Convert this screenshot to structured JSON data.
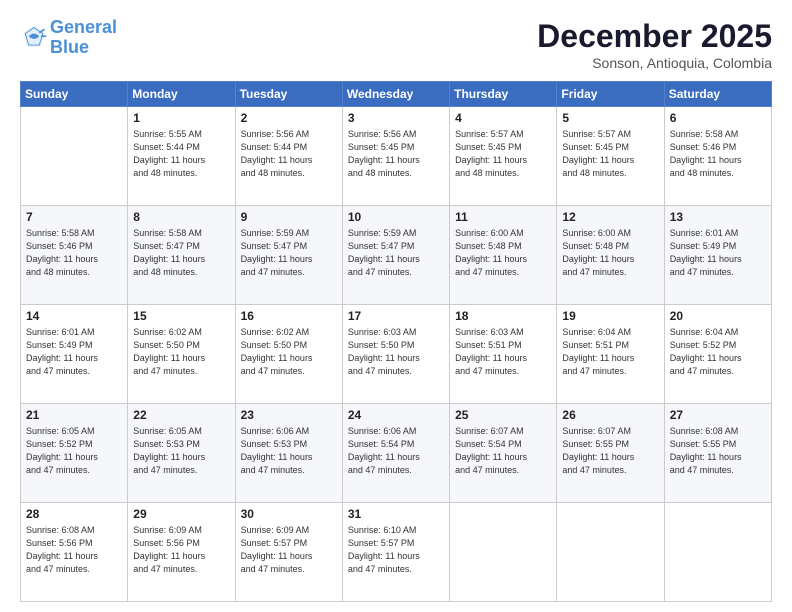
{
  "header": {
    "logo_line1": "General",
    "logo_line2": "Blue",
    "month_title": "December 2025",
    "location": "Sonson, Antioquia, Colombia"
  },
  "weekdays": [
    "Sunday",
    "Monday",
    "Tuesday",
    "Wednesday",
    "Thursday",
    "Friday",
    "Saturday"
  ],
  "weeks": [
    [
      {
        "day": "",
        "sunrise": "",
        "sunset": "",
        "daylight": ""
      },
      {
        "day": "1",
        "sunrise": "Sunrise: 5:55 AM",
        "sunset": "Sunset: 5:44 PM",
        "daylight": "Daylight: 11 hours and 48 minutes."
      },
      {
        "day": "2",
        "sunrise": "Sunrise: 5:56 AM",
        "sunset": "Sunset: 5:44 PM",
        "daylight": "Daylight: 11 hours and 48 minutes."
      },
      {
        "day": "3",
        "sunrise": "Sunrise: 5:56 AM",
        "sunset": "Sunset: 5:45 PM",
        "daylight": "Daylight: 11 hours and 48 minutes."
      },
      {
        "day": "4",
        "sunrise": "Sunrise: 5:57 AM",
        "sunset": "Sunset: 5:45 PM",
        "daylight": "Daylight: 11 hours and 48 minutes."
      },
      {
        "day": "5",
        "sunrise": "Sunrise: 5:57 AM",
        "sunset": "Sunset: 5:45 PM",
        "daylight": "Daylight: 11 hours and 48 minutes."
      },
      {
        "day": "6",
        "sunrise": "Sunrise: 5:58 AM",
        "sunset": "Sunset: 5:46 PM",
        "daylight": "Daylight: 11 hours and 48 minutes."
      }
    ],
    [
      {
        "day": "7",
        "sunrise": "Sunrise: 5:58 AM",
        "sunset": "Sunset: 5:46 PM",
        "daylight": "Daylight: 11 hours and 48 minutes."
      },
      {
        "day": "8",
        "sunrise": "Sunrise: 5:58 AM",
        "sunset": "Sunset: 5:47 PM",
        "daylight": "Daylight: 11 hours and 48 minutes."
      },
      {
        "day": "9",
        "sunrise": "Sunrise: 5:59 AM",
        "sunset": "Sunset: 5:47 PM",
        "daylight": "Daylight: 11 hours and 47 minutes."
      },
      {
        "day": "10",
        "sunrise": "Sunrise: 5:59 AM",
        "sunset": "Sunset: 5:47 PM",
        "daylight": "Daylight: 11 hours and 47 minutes."
      },
      {
        "day": "11",
        "sunrise": "Sunrise: 6:00 AM",
        "sunset": "Sunset: 5:48 PM",
        "daylight": "Daylight: 11 hours and 47 minutes."
      },
      {
        "day": "12",
        "sunrise": "Sunrise: 6:00 AM",
        "sunset": "Sunset: 5:48 PM",
        "daylight": "Daylight: 11 hours and 47 minutes."
      },
      {
        "day": "13",
        "sunrise": "Sunrise: 6:01 AM",
        "sunset": "Sunset: 5:49 PM",
        "daylight": "Daylight: 11 hours and 47 minutes."
      }
    ],
    [
      {
        "day": "14",
        "sunrise": "Sunrise: 6:01 AM",
        "sunset": "Sunset: 5:49 PM",
        "daylight": "Daylight: 11 hours and 47 minutes."
      },
      {
        "day": "15",
        "sunrise": "Sunrise: 6:02 AM",
        "sunset": "Sunset: 5:50 PM",
        "daylight": "Daylight: 11 hours and 47 minutes."
      },
      {
        "day": "16",
        "sunrise": "Sunrise: 6:02 AM",
        "sunset": "Sunset: 5:50 PM",
        "daylight": "Daylight: 11 hours and 47 minutes."
      },
      {
        "day": "17",
        "sunrise": "Sunrise: 6:03 AM",
        "sunset": "Sunset: 5:50 PM",
        "daylight": "Daylight: 11 hours and 47 minutes."
      },
      {
        "day": "18",
        "sunrise": "Sunrise: 6:03 AM",
        "sunset": "Sunset: 5:51 PM",
        "daylight": "Daylight: 11 hours and 47 minutes."
      },
      {
        "day": "19",
        "sunrise": "Sunrise: 6:04 AM",
        "sunset": "Sunset: 5:51 PM",
        "daylight": "Daylight: 11 hours and 47 minutes."
      },
      {
        "day": "20",
        "sunrise": "Sunrise: 6:04 AM",
        "sunset": "Sunset: 5:52 PM",
        "daylight": "Daylight: 11 hours and 47 minutes."
      }
    ],
    [
      {
        "day": "21",
        "sunrise": "Sunrise: 6:05 AM",
        "sunset": "Sunset: 5:52 PM",
        "daylight": "Daylight: 11 hours and 47 minutes."
      },
      {
        "day": "22",
        "sunrise": "Sunrise: 6:05 AM",
        "sunset": "Sunset: 5:53 PM",
        "daylight": "Daylight: 11 hours and 47 minutes."
      },
      {
        "day": "23",
        "sunrise": "Sunrise: 6:06 AM",
        "sunset": "Sunset: 5:53 PM",
        "daylight": "Daylight: 11 hours and 47 minutes."
      },
      {
        "day": "24",
        "sunrise": "Sunrise: 6:06 AM",
        "sunset": "Sunset: 5:54 PM",
        "daylight": "Daylight: 11 hours and 47 minutes."
      },
      {
        "day": "25",
        "sunrise": "Sunrise: 6:07 AM",
        "sunset": "Sunset: 5:54 PM",
        "daylight": "Daylight: 11 hours and 47 minutes."
      },
      {
        "day": "26",
        "sunrise": "Sunrise: 6:07 AM",
        "sunset": "Sunset: 5:55 PM",
        "daylight": "Daylight: 11 hours and 47 minutes."
      },
      {
        "day": "27",
        "sunrise": "Sunrise: 6:08 AM",
        "sunset": "Sunset: 5:55 PM",
        "daylight": "Daylight: 11 hours and 47 minutes."
      }
    ],
    [
      {
        "day": "28",
        "sunrise": "Sunrise: 6:08 AM",
        "sunset": "Sunset: 5:56 PM",
        "daylight": "Daylight: 11 hours and 47 minutes."
      },
      {
        "day": "29",
        "sunrise": "Sunrise: 6:09 AM",
        "sunset": "Sunset: 5:56 PM",
        "daylight": "Daylight: 11 hours and 47 minutes."
      },
      {
        "day": "30",
        "sunrise": "Sunrise: 6:09 AM",
        "sunset": "Sunset: 5:57 PM",
        "daylight": "Daylight: 11 hours and 47 minutes."
      },
      {
        "day": "31",
        "sunrise": "Sunrise: 6:10 AM",
        "sunset": "Sunset: 5:57 PM",
        "daylight": "Daylight: 11 hours and 47 minutes."
      },
      {
        "day": "",
        "sunrise": "",
        "sunset": "",
        "daylight": ""
      },
      {
        "day": "",
        "sunrise": "",
        "sunset": "",
        "daylight": ""
      },
      {
        "day": "",
        "sunrise": "",
        "sunset": "",
        "daylight": ""
      }
    ]
  ]
}
